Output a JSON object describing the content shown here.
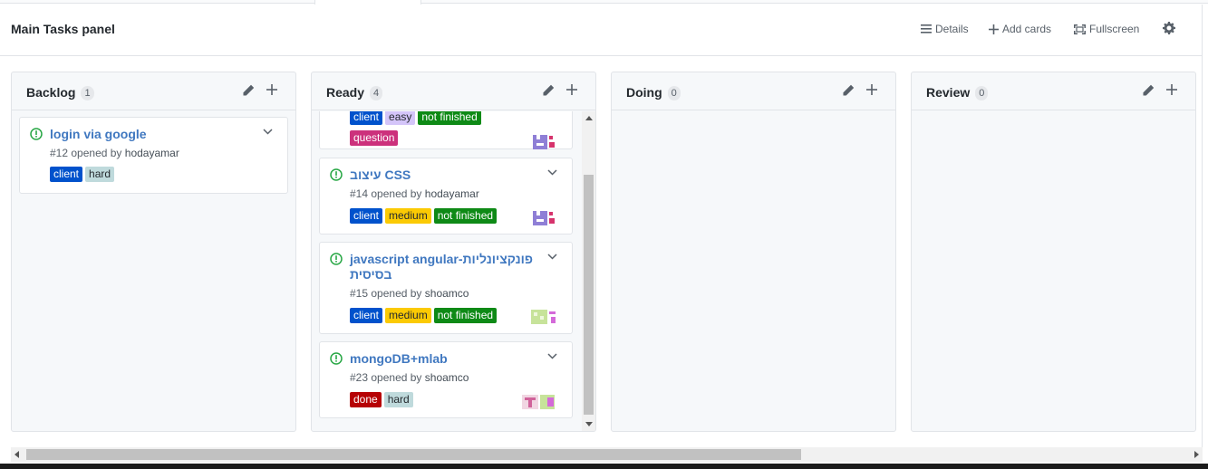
{
  "header": {
    "title": "Main Tasks panel",
    "details_label": "Details",
    "add_cards_label": "Add cards",
    "fullscreen_label": "Fullscreen"
  },
  "colors": {
    "link": "#4078c0",
    "open_icon": "#28a745",
    "label_client": "#0052cc",
    "label_hard": "#bfdadc",
    "label_medium": "#fbca04",
    "label_not_finished": "#0e8a16",
    "label_question": "#cc317c",
    "label_done": "#b60205",
    "label_easy": "#d4c5f9"
  },
  "columns": [
    {
      "name": "Backlog",
      "count": "1",
      "cards": [
        {
          "title": "login via google",
          "number": "#12",
          "opened_by": "opened by",
          "user": "hodayamar",
          "labels": [
            {
              "text": "client",
              "bg": "#0052cc",
              "fg": "#ffffff"
            },
            {
              "text": "hard",
              "bg": "#bfdadc",
              "fg": "#24292e"
            }
          ]
        }
      ]
    },
    {
      "name": "Ready",
      "count": "4",
      "cards": [
        {
          "title": "",
          "number": "",
          "opened_by": "",
          "user": "",
          "labels_partial": [
            {
              "text": "client",
              "bg": "#0052cc",
              "fg": "#ffffff"
            },
            {
              "text": "easy",
              "bg": "#d4c5f9",
              "fg": "#24292e"
            },
            {
              "text": "not finished",
              "bg": "#0e8a16",
              "fg": "#ffffff"
            }
          ],
          "labels": [
            {
              "text": "question",
              "bg": "#cc317c",
              "fg": "#ffffff"
            }
          ]
        },
        {
          "title": "עיצוב CSS",
          "number": "#14",
          "opened_by": "opened by",
          "user": "hodayamar",
          "labels": [
            {
              "text": "client",
              "bg": "#0052cc",
              "fg": "#ffffff"
            },
            {
              "text": "medium",
              "bg": "#fbca04",
              "fg": "#24292e"
            },
            {
              "text": "not finished",
              "bg": "#0e8a16",
              "fg": "#ffffff"
            }
          ]
        },
        {
          "title": "javascript angular-פונקציונליות",
          "title_line2": "בסיסית",
          "number": "#15",
          "opened_by": "opened by",
          "user": "shoamco",
          "labels": [
            {
              "text": "client",
              "bg": "#0052cc",
              "fg": "#ffffff"
            },
            {
              "text": "medium",
              "bg": "#fbca04",
              "fg": "#24292e"
            },
            {
              "text": "not finished",
              "bg": "#0e8a16",
              "fg": "#ffffff"
            }
          ]
        },
        {
          "title": "mongoDB+mlab",
          "number": "#23",
          "opened_by": "opened by",
          "user": "shoamco",
          "labels": [
            {
              "text": "done",
              "bg": "#b60205",
              "fg": "#ffffff"
            },
            {
              "text": "hard",
              "bg": "#bfdadc",
              "fg": "#24292e"
            }
          ]
        }
      ]
    },
    {
      "name": "Doing",
      "count": "0",
      "cards": []
    },
    {
      "name": "Review",
      "count": "0",
      "cards": []
    }
  ]
}
